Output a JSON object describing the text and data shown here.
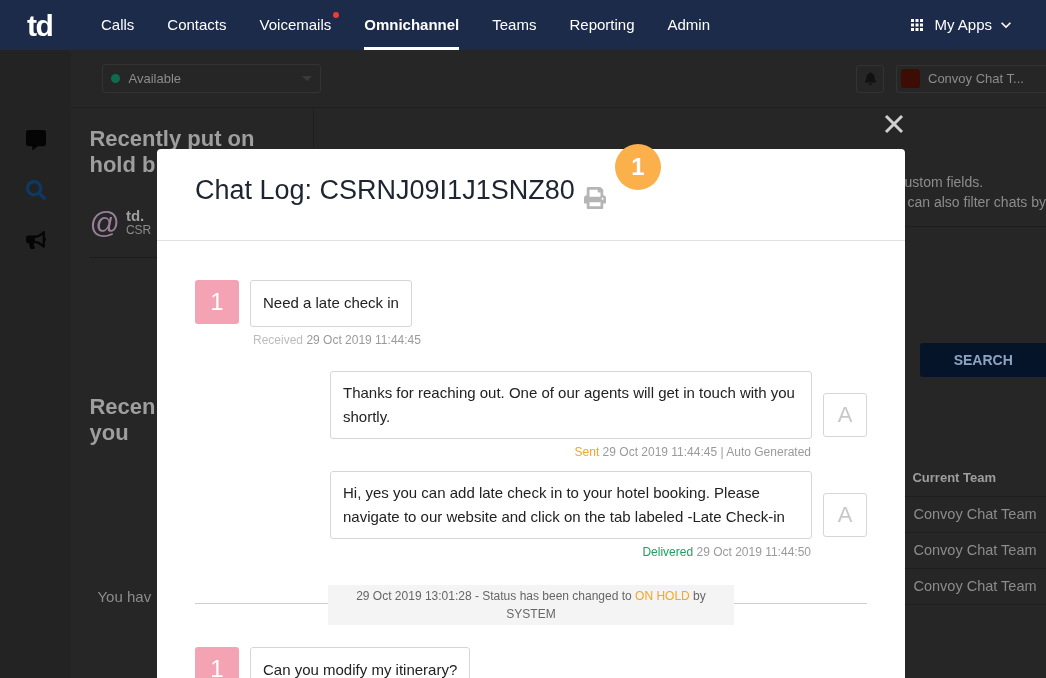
{
  "nav": {
    "logo": "td",
    "items": [
      {
        "label": "Calls",
        "selected": false,
        "notification": false
      },
      {
        "label": "Contacts",
        "selected": false,
        "notification": false
      },
      {
        "label": "Voicemails",
        "selected": false,
        "notification": true
      },
      {
        "label": "Omnichannel",
        "selected": true,
        "notification": false
      },
      {
        "label": "Teams",
        "selected": false,
        "notification": false
      },
      {
        "label": "Reporting",
        "selected": false,
        "notification": false
      },
      {
        "label": "Admin",
        "selected": false,
        "notification": false
      }
    ],
    "apps": "My Apps"
  },
  "toolbar": {
    "status": {
      "label": "Available",
      "color": "#0e6b4f"
    },
    "team": "Convoy Chat T..."
  },
  "sidebar": {
    "items": [
      {
        "kind": "chat",
        "selected": false
      },
      {
        "kind": "search",
        "selected": true
      },
      {
        "kind": "megaphone",
        "selected": false
      }
    ]
  },
  "left_panel": {
    "title_lines": [
      "Recently put on",
      "hold b"
    ],
    "item": {
      "icon": "@",
      "name": "td.",
      "sub": "CSR"
    },
    "second_title_lines": [
      "Recen",
      "you"
    ],
    "empty_text": "You hav"
  },
  "right_panel": {
    "help_lines": [
      "ustom fields.",
      "can also filter chats by"
    ],
    "search_button": "SEARCH",
    "table": {
      "columns": [
        "Current Team"
      ],
      "rows": [
        [
          "Convoy Chat Team"
        ],
        [
          "Convoy Chat Team"
        ],
        [
          "Convoy Chat Team"
        ]
      ]
    }
  },
  "modal": {
    "title": "Chat Log: CSRNJ09I1J1SNZ80",
    "badge": "1",
    "messages": [
      {
        "kind": "customer",
        "avatar": "1",
        "text": "Need a late check in",
        "status": "Received",
        "color": "#bdbdbd",
        "time": "29 Oct 2019 11:44:45"
      },
      {
        "kind": "agent",
        "avatar": "A",
        "text": "Thanks for reaching out. One of our agents will get in touch with you shortly.",
        "status": "Sent",
        "color": "#f5a623",
        "time": "29 Oct 2019 11:44:45 | Auto Generated"
      },
      {
        "kind": "agent",
        "avatar": "A",
        "text": "Hi, yes you can add late check in to your hotel booking. Please navigate to our website and click on the tab labeled -Late Check-in",
        "status": "Delivered",
        "color": "#1aa260",
        "time": "29 Oct 2019 11:44:50"
      },
      {
        "kind": "event",
        "prefix": "29 Oct 2019 13:01:28 - Status has been changed to",
        "highlight": "ON HOLD",
        "suffix": "by SYSTEM"
      },
      {
        "kind": "customer",
        "avatar": "1",
        "text": "Can you modify my itinerary?"
      }
    ]
  }
}
